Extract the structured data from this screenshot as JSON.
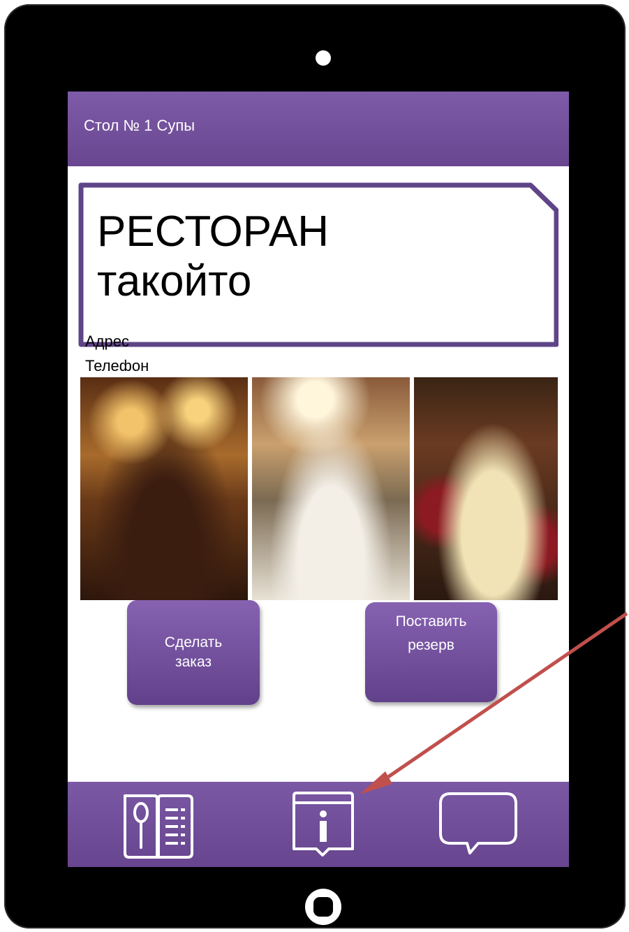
{
  "app": {
    "header_title": "Стол № 1 Супы"
  },
  "restaurant": {
    "name": "РЕСТОРАН",
    "subtitle": "такойто",
    "address_label": "Адрес",
    "phone_label": "Телефон"
  },
  "actions": {
    "order_line1": "Сделать",
    "order_line2": "заказ",
    "reserve_line1": "Поставить",
    "reserve_line2": "резерв"
  },
  "tabbar": {
    "items": [
      {
        "icon": "menu-book-icon"
      },
      {
        "icon": "info-icon"
      },
      {
        "icon": "chat-bubble-icon"
      }
    ]
  },
  "colors": {
    "accent": "#7a58a4",
    "annotation_arrow": "#c0504d",
    "device": "#000000"
  }
}
